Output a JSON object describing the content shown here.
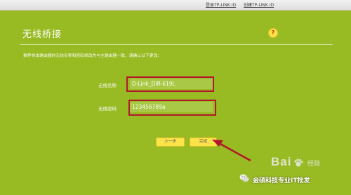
{
  "header": {
    "login_link": "登录TP-LINK ID",
    "create_link": "创建TP-LINK ID"
  },
  "page": {
    "title": "无线桥接",
    "help_glyph": "?",
    "instruction": "推荐将本路由器的无线名称和密码修改为与主路由器一致，请确认以下更改："
  },
  "form": {
    "ssid_label": "无线名称",
    "ssid_value": "D-Link_DIR-619L",
    "password_label": "无线密码",
    "password_value": "123456789a"
  },
  "buttons": {
    "prev_label": "上一步",
    "finish_label": "完成"
  },
  "watermark": {
    "baidu": "Bai",
    "baidu_suffix": "经验",
    "wechat_line": "金硕科技专业IT批发"
  },
  "colors": {
    "background": "#98ba22",
    "button": "#fde24a",
    "highlight": "#b3172c"
  }
}
